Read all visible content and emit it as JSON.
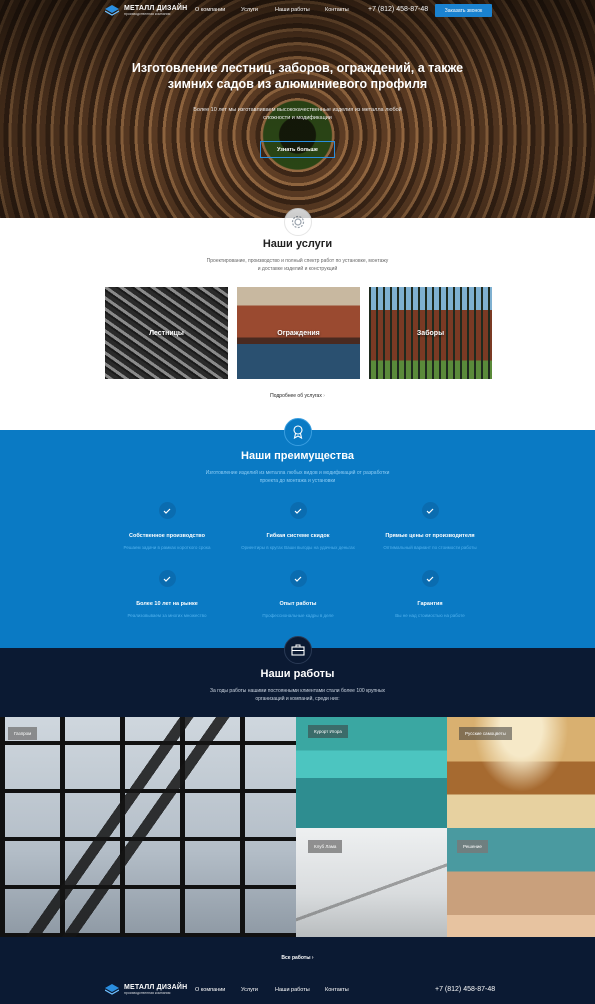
{
  "header": {
    "logo_title": "МЕТАЛЛ ДИЗАЙН",
    "logo_subtitle": "производственная компания",
    "nav": [
      "О компании",
      "Услуги",
      "Наши работы",
      "Контакты"
    ],
    "phone": "+7 (812) 458-87-48",
    "order_button": "Заказать звонок"
  },
  "hero": {
    "title": "Изготовление лестниц, заборов, ограждений, а также зимних садов из алюминиевого профиля",
    "description": "Более 10 лет мы изготавливаем высококачественные изделия из металла любой сложности и модификации",
    "button": "Узнать больше"
  },
  "services": {
    "title": "Наши услуги",
    "description": "Проектирование, производство и полный спектр работ по установке, монтажу и доставке изделий и конструкций",
    "cards": [
      "Лестницы",
      "Ограждения",
      "Заборы"
    ],
    "more_link": "Подробнее об услугах"
  },
  "advantages": {
    "title": "Наши преимущества",
    "description": "Изготовление изделий из металла любых видов и модификаций от разработки проекта до монтажа и установки",
    "items": [
      {
        "title": "Собственное производство",
        "subtitle": "Решаем задачи в рамках короткого срока"
      },
      {
        "title": "Гибкая системе скидок",
        "subtitle": "Ориентиры в кругах Ваши выгоды на удачных деньгах"
      },
      {
        "title": "Прямые цены от производителя",
        "subtitle": "Оптимальный вариант по стоимости работы"
      },
      {
        "title": "Более 10 лет на рынке",
        "subtitle": "Реализовываем за многих множество"
      },
      {
        "title": "Опыт работы",
        "subtitle": "Профессиональные кадры в деле"
      },
      {
        "title": "Гарантия",
        "subtitle": "Вы не над стоимостью на работе"
      }
    ]
  },
  "works": {
    "title": "Наши работы",
    "description": "За годы работы нашими постоянными клиентами стали более 100 крупных организаций и компаний, среди них:",
    "tags": [
      "Газпром",
      "Курорт Игора",
      "Русские самоцветы",
      "Клуб Лама",
      "Решение"
    ],
    "all_link": "Все работы"
  },
  "footer": {
    "logo_title": "МЕТАЛЛ ДИЗАЙН",
    "logo_subtitle": "производственная компания",
    "nav": [
      "О компании",
      "Услуги",
      "Наши работы",
      "Контакты"
    ],
    "phone": "+7 (812) 458-87-48"
  },
  "colors": {
    "accent_blue": "#0a7ac4",
    "dark_navy": "#0b1a33",
    "button_blue": "#1a82d0"
  }
}
